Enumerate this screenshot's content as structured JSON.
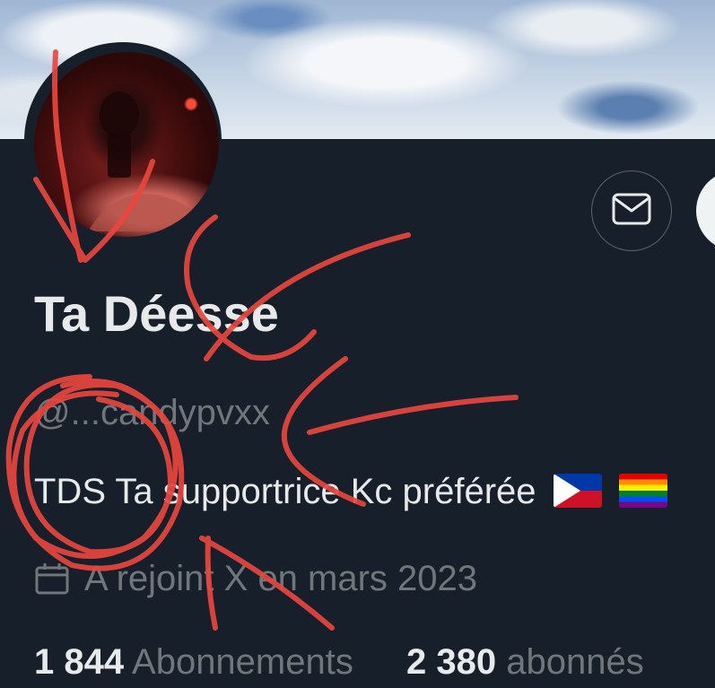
{
  "profile": {
    "display_name": "Ta Déesse",
    "handle": "@...candypvxx",
    "bio_text": "TDS Ta supportrice Kc préférée",
    "bio_flags": [
      "philippines-flag",
      "rainbow-flag"
    ],
    "joined": "A rejoint X en mars 2023"
  },
  "stats": {
    "following_count": "1 844",
    "following_label": "Abonnements",
    "followers_count": "2 380",
    "followers_label": "abonnés"
  },
  "icons": {
    "message": "envelope-icon",
    "joined": "calendar-icon"
  },
  "colors": {
    "background": "#17202a",
    "text_primary": "#e7e9ea",
    "text_secondary": "#71767b",
    "annotation": "#e8473e"
  }
}
